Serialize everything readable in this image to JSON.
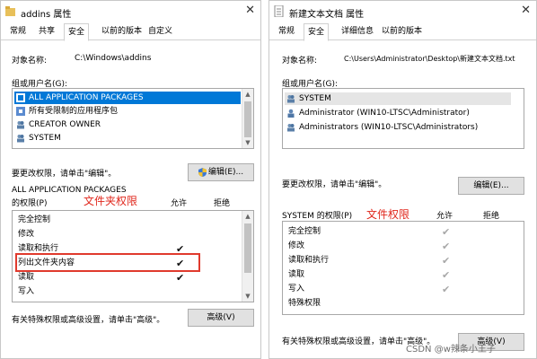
{
  "left": {
    "title": "addins 属性",
    "tabs": [
      "常规",
      "共享",
      "安全",
      "以前的版本",
      "自定义"
    ],
    "object_label": "对象名称:",
    "object_value": "C:\\Windows\\addins",
    "group_label": "组或用户名(G):",
    "groups": [
      "ALL APPLICATION PACKAGES",
      "所有受限制的应用程序包",
      "CREATOR OWNER",
      "SYSTEM"
    ],
    "change_text": "要更改权限，请单击\"编辑\"。",
    "edit_button": "编辑(E)...",
    "perm_label_line1": "ALL APPLICATION PACKAGES",
    "perm_label_line2": "的权限(P)",
    "annotation": "文件夹权限",
    "allow_header": "允许",
    "deny_header": "拒绝",
    "perms": [
      "完全控制",
      "修改",
      "读取和执行",
      "列出文件夹内容",
      "读取",
      "写入"
    ],
    "footer_text": "有关特殊权限或高级设置，请单击\"高级\"。",
    "advanced_button": "高级(V)"
  },
  "right": {
    "title": "新建文本文档 属性",
    "tabs": [
      "常规",
      "安全",
      "详细信息",
      "以前的版本"
    ],
    "object_label": "对象名称:",
    "object_value": "C:\\Users\\Administrator\\Desktop\\新建文本文档.txt",
    "group_label": "组或用户名(G):",
    "groups": [
      "SYSTEM",
      "Administrator (WIN10-LTSC\\Administrator)",
      "Administrators (WIN10-LTSC\\Administrators)"
    ],
    "change_text": "要更改权限，请单击\"编辑\"。",
    "edit_button": "编辑(E)...",
    "perm_label": "SYSTEM 的权限(P)",
    "annotation": "文件权限",
    "allow_header": "允许",
    "deny_header": "拒绝",
    "perms": [
      "完全控制",
      "修改",
      "读取和执行",
      "读取",
      "写入",
      "特殊权限"
    ],
    "footer_text": "有关特殊权限或高级设置，请单击\"高级\"。",
    "advanced_button": "高级(V)",
    "watermark": "CSDN @w辣条小王子"
  },
  "colors": {
    "selection": "#0078d7",
    "annotation": "#e0261b",
    "redbox": "#e03a2d"
  }
}
